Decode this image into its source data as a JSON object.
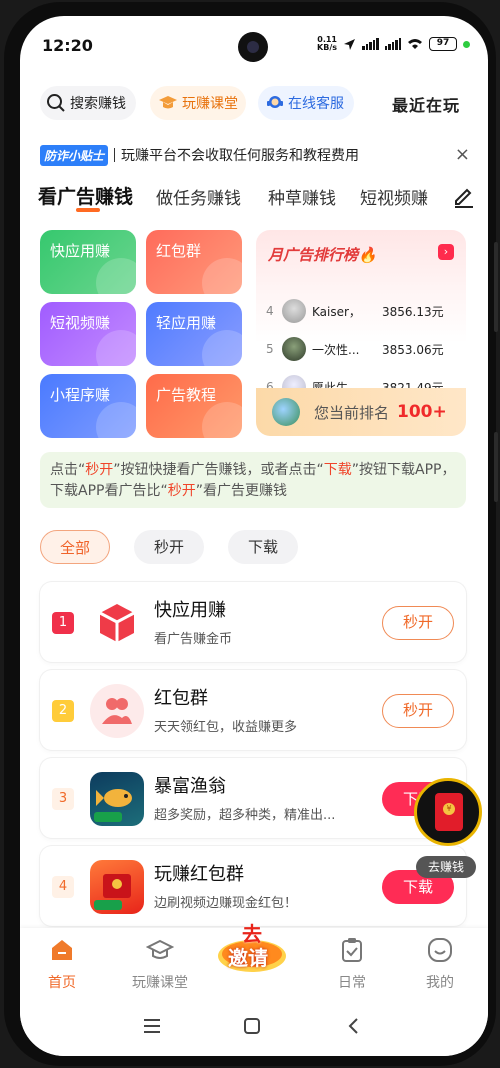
{
  "status": {
    "time": "12:20",
    "net_speed_top": "0.11",
    "net_speed_unit": "KB/s",
    "battery": "97"
  },
  "toolbar": {
    "search": "搜索赚钱",
    "course": "玩赚课堂",
    "service": "在线客服",
    "recent": "最近在玩"
  },
  "tip": {
    "badge": "防诈小贴士",
    "text": "玩赚平台不会收取任何服务和教程费用",
    "close": "×"
  },
  "tabs": [
    "看广告赚钱",
    "做任务赚钱",
    "种草赚钱",
    "短视频赚"
  ],
  "tiles": [
    "快应用赚",
    "红包群",
    "短视频赚",
    "轻应用赚",
    "小程序赚",
    "广告教程"
  ],
  "ranking": {
    "title": "月广告排行榜🔥",
    "rows": [
      {
        "rank": "4",
        "name": "Kaiser，",
        "amount": "3856.13元"
      },
      {
        "rank": "5",
        "name": "一次性...",
        "amount": "3853.06元"
      },
      {
        "rank": "6",
        "name": "愿此生...",
        "amount": "3821.49元"
      }
    ],
    "my_label": "您当前排名",
    "my_value": "100+"
  },
  "hint": {
    "p1": "点击“",
    "h1": "秒开",
    "p2": "”按钮快捷看广告赚钱，或者点击“",
    "h2": "下载",
    "p3": "”按钮下载APP，下载APP看广告比“",
    "h3": "秒开",
    "p4": "”看广告更赚钱"
  },
  "filters": [
    "全部",
    "秒开",
    "下载"
  ],
  "list": [
    {
      "rank": "1",
      "name": "快应用赚",
      "desc": "看广告赚金币",
      "action": "秒开"
    },
    {
      "rank": "2",
      "name": "红包群",
      "desc": "天天领红包，收益赚更多",
      "action": "秒开"
    },
    {
      "rank": "3",
      "name": "暴富渔翁",
      "desc": "超多奖励，超多种类，精准出...",
      "action": "下载"
    },
    {
      "rank": "4",
      "name": "玩赚红包群",
      "desc": "边刷视频边赚现金红包！",
      "action": "下载"
    }
  ],
  "float_label": "去赚钱",
  "nav": {
    "home": "首页",
    "course": "玩赚课堂",
    "invite_top": "去",
    "invite_bottom": "邀请",
    "daily": "日常",
    "mine": "我的"
  },
  "colors": {
    "accent": "#f06a2a",
    "red": "#ff2c55",
    "blue": "#2d7ff9"
  }
}
